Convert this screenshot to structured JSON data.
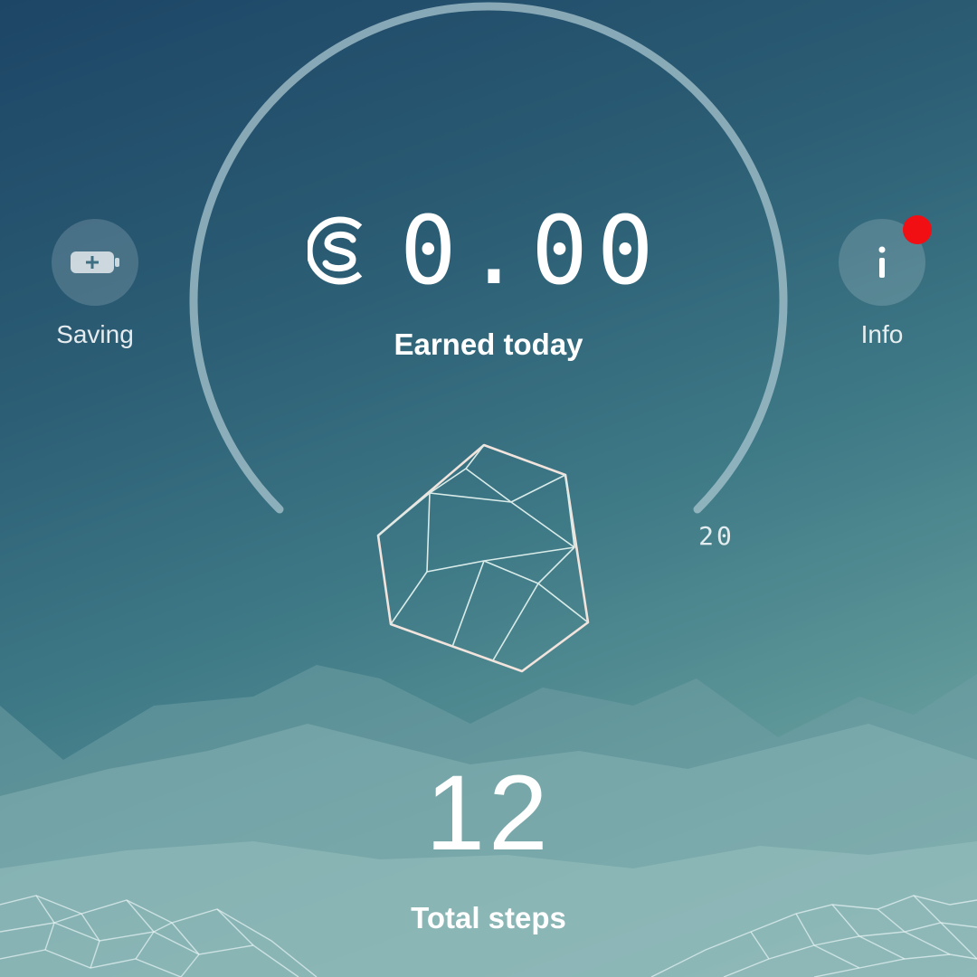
{
  "earnings": {
    "currency_icon": "sweatcoin-icon",
    "amount": "0.00",
    "label": "Earned today"
  },
  "progress": {
    "goal_label": "20",
    "steps_done": 12,
    "goal": 20
  },
  "steps": {
    "value": "12",
    "label": "Total steps"
  },
  "left_action": {
    "icon": "battery-plus-icon",
    "label": "Saving"
  },
  "right_action": {
    "icon": "info-icon",
    "label": "Info",
    "has_notification": true
  },
  "colors": {
    "background_top": "#1d4566",
    "background_bottom": "#84b3b1",
    "ring": "#a9c6cf",
    "notification": "#f10f14",
    "text": "#ffffff"
  }
}
